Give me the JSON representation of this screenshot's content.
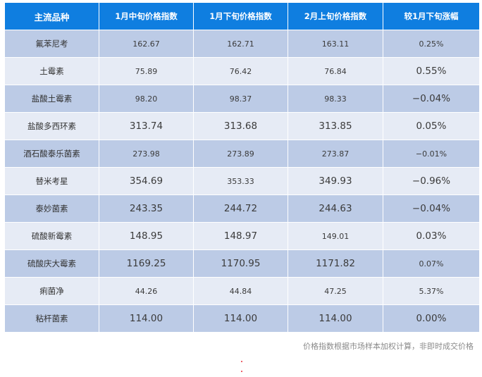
{
  "table": {
    "headers": [
      "主流品种",
      "1月中旬价格指数",
      "1月下旬价格指数",
      "2月上旬价格指数",
      "较1月下旬涨幅"
    ],
    "rows": [
      {
        "name": "氟苯尼考",
        "jan_mid": "162.67",
        "jan_late": "162.71",
        "feb_early": "163.11",
        "change": "0.25%",
        "trend": "up"
      },
      {
        "name": "土霉素",
        "jan_mid": "75.89",
        "jan_late": "76.42",
        "feb_early": "76.84",
        "change": "0.55%",
        "trend": "up"
      },
      {
        "name": "盐酸土霉素",
        "jan_mid": "98.20",
        "jan_late": "98.37",
        "feb_early": "98.33",
        "change": "−0.04%",
        "trend": "down"
      },
      {
        "name": "盐酸多西环素",
        "jan_mid": "313.74",
        "jan_late": "313.68",
        "feb_early": "313.85",
        "change": "0.05%",
        "trend": "up"
      },
      {
        "name": "酒石酸泰乐菌素",
        "jan_mid": "273.98",
        "jan_late": "273.89",
        "feb_early": "273.87",
        "change": "−0.01%",
        "trend": "down"
      },
      {
        "name": "替米考星",
        "jan_mid": "354.69",
        "jan_late": "353.33",
        "feb_early": "349.93",
        "change": "−0.96%",
        "trend": "down"
      },
      {
        "name": "泰妙菌素",
        "jan_mid": "243.35",
        "jan_late": "244.72",
        "feb_early": "244.63",
        "change": "−0.04%",
        "trend": "down"
      },
      {
        "name": "硫酸新霉素",
        "jan_mid": "148.95",
        "jan_late": "148.97",
        "feb_early": "149.01",
        "change": "0.03%",
        "trend": "up"
      },
      {
        "name": "硫酸庆大霉素",
        "jan_mid": "1169.25",
        "jan_late": "1170.95",
        "feb_early": "1171.82",
        "change": "0.07%",
        "trend": "up"
      },
      {
        "name": "痢菌净",
        "jan_mid": "44.26",
        "jan_late": "44.84",
        "feb_early": "47.25",
        "change": "5.37%",
        "trend": "up"
      },
      {
        "name": "粘杆菌素",
        "jan_mid": "114.00",
        "jan_late": "114.00",
        "feb_early": "114.00",
        "change": "0.00%",
        "trend": "flat"
      }
    ]
  },
  "footnote": "价格指数根据市场样本加权计算，非即时成交价格",
  "colors": {
    "header_bg": "#0f7ee0",
    "row_dark": "#bccbe6",
    "row_light": "#e6ebf5",
    "rise": "#e8303c",
    "fall": "#3a8a2e",
    "flat": "#b9bfcb"
  }
}
